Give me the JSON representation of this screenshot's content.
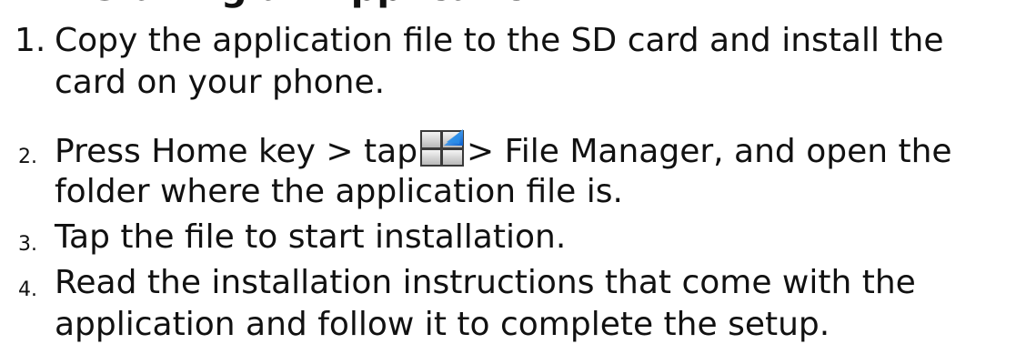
{
  "heading_partial": "Installing an Application",
  "steps": [
    {
      "number": "1.",
      "lines": [
        "Copy the application file to the SD card and install the",
        "card on your phone."
      ]
    },
    {
      "number": "2.",
      "before_icon": "Press Home key > tap",
      "icon": "app-launcher-grid-icon",
      "after_icon": "> File Manager, and open the",
      "lines": [
        "folder where the application file is."
      ]
    },
    {
      "number": "3.",
      "lines": [
        "Tap the file to start installation."
      ]
    },
    {
      "number": "4.",
      "lines": [
        "Read the installation instructions that come with the",
        "application and follow it to complete the setup."
      ]
    }
  ]
}
